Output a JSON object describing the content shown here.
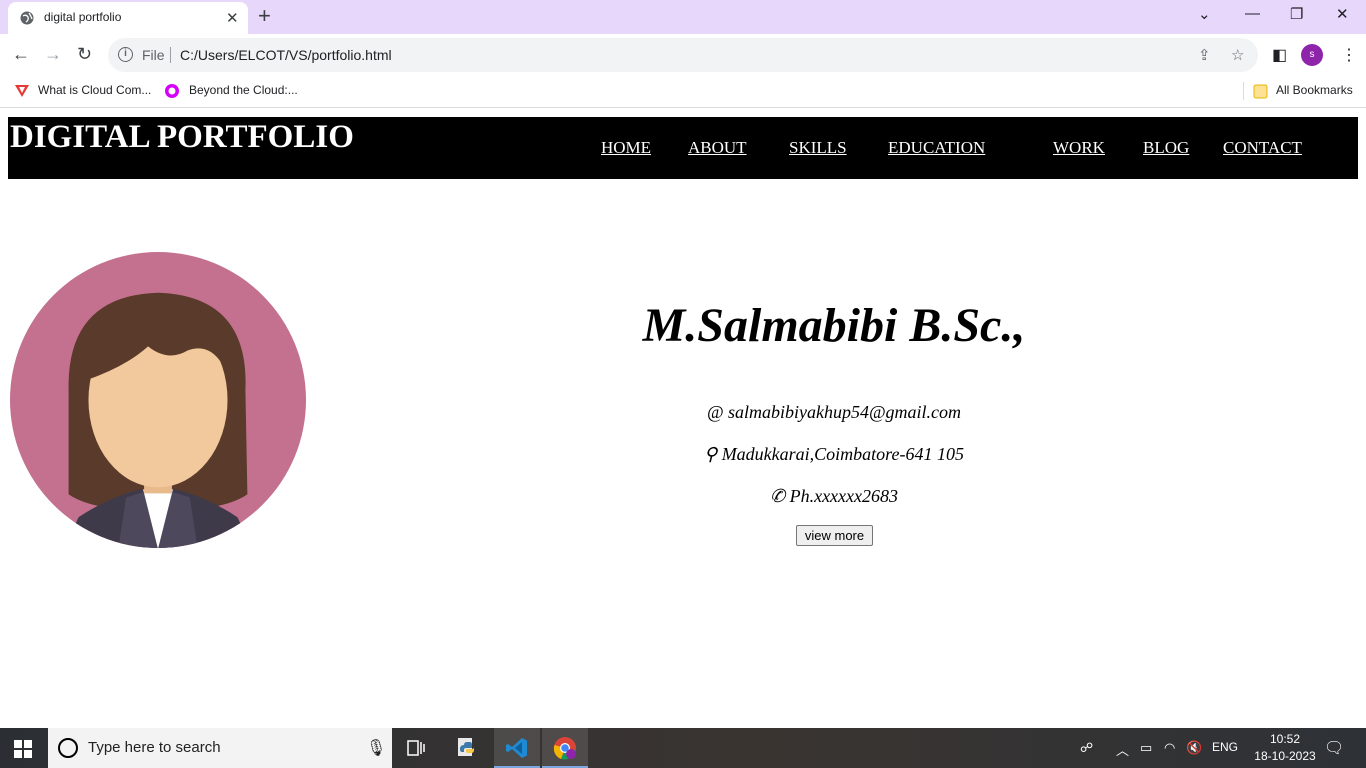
{
  "browser": {
    "tab_title": "digital portfolio",
    "url_scheme": "File",
    "url": "C:/Users/ELCOT/VS/portfolio.html",
    "profile_initial": "s",
    "bookmarks": [
      {
        "label": "What is Cloud Com..."
      },
      {
        "label": "Beyond the Cloud:..."
      }
    ],
    "all_bookmarks": "All Bookmarks"
  },
  "page": {
    "site_title": "DIGITAL PORTFOLIO",
    "nav": [
      "HOME",
      "ABOUT",
      "SKILLS",
      "EDUCATION",
      "WORK",
      "BLOG",
      "CONTACT"
    ],
    "name": "M.Salmabibi B.Sc.,",
    "email_icon": "@",
    "email": "salmabibiyakhup54@gmail.com",
    "location_icon": "⚲",
    "location": "Madukkarai,Coimbatore-641 105",
    "phone_icon": "✆",
    "phone": "Ph.xxxxxx2683",
    "view_more": "view more"
  },
  "taskbar": {
    "search_placeholder": "Type here to search",
    "language": "ENG",
    "time": "10:52",
    "date": "18-10-2023"
  },
  "colors": {
    "tabstrip": "#e6d7fb",
    "header_bg": "#000000",
    "avatar_bg": "#c4718f",
    "hair": "#5a3a2a",
    "skin": "#f1c99c",
    "profile": "#8e24aa"
  }
}
